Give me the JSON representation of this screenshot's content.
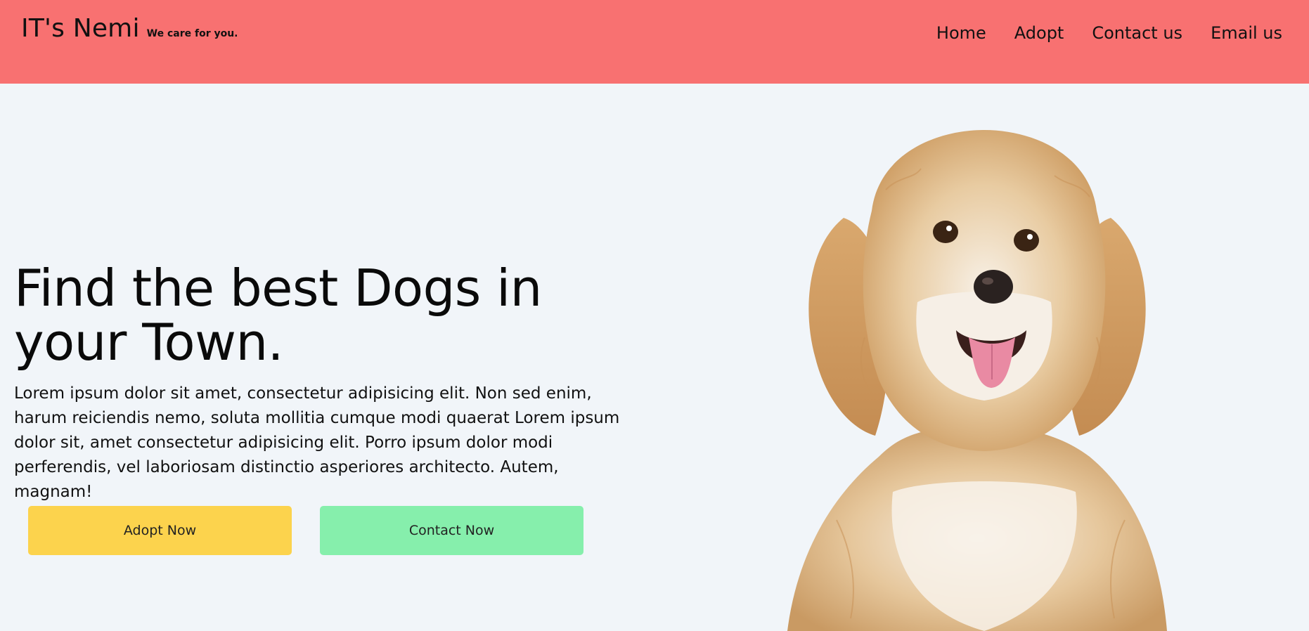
{
  "header": {
    "brand_name": "IT's Nemi",
    "tagline": "We care for you.",
    "background_color": "#f87171",
    "nav": [
      "Home",
      "Adopt",
      "Contact us",
      "Email us"
    ]
  },
  "hero": {
    "title": "Find the best Dogs in your Town.",
    "description": "Lorem ipsum dolor sit amet, consectetur adipisicing elit. Non sed enim, harum reiciendis nemo, soluta mollitia cumque modi quaerat Lorem ipsum dolor sit, amet consectetur adipisicing elit. Porro ipsum dolor modi perferendis, vel laboriosam distinctio asperiores architecto. Autem, magnam!",
    "adopt_button": "Adopt Now",
    "contact_button": "Contact Now",
    "adopt_color": "#fcd34d",
    "contact_color": "#86efac",
    "image_icon": "dog-photo"
  }
}
